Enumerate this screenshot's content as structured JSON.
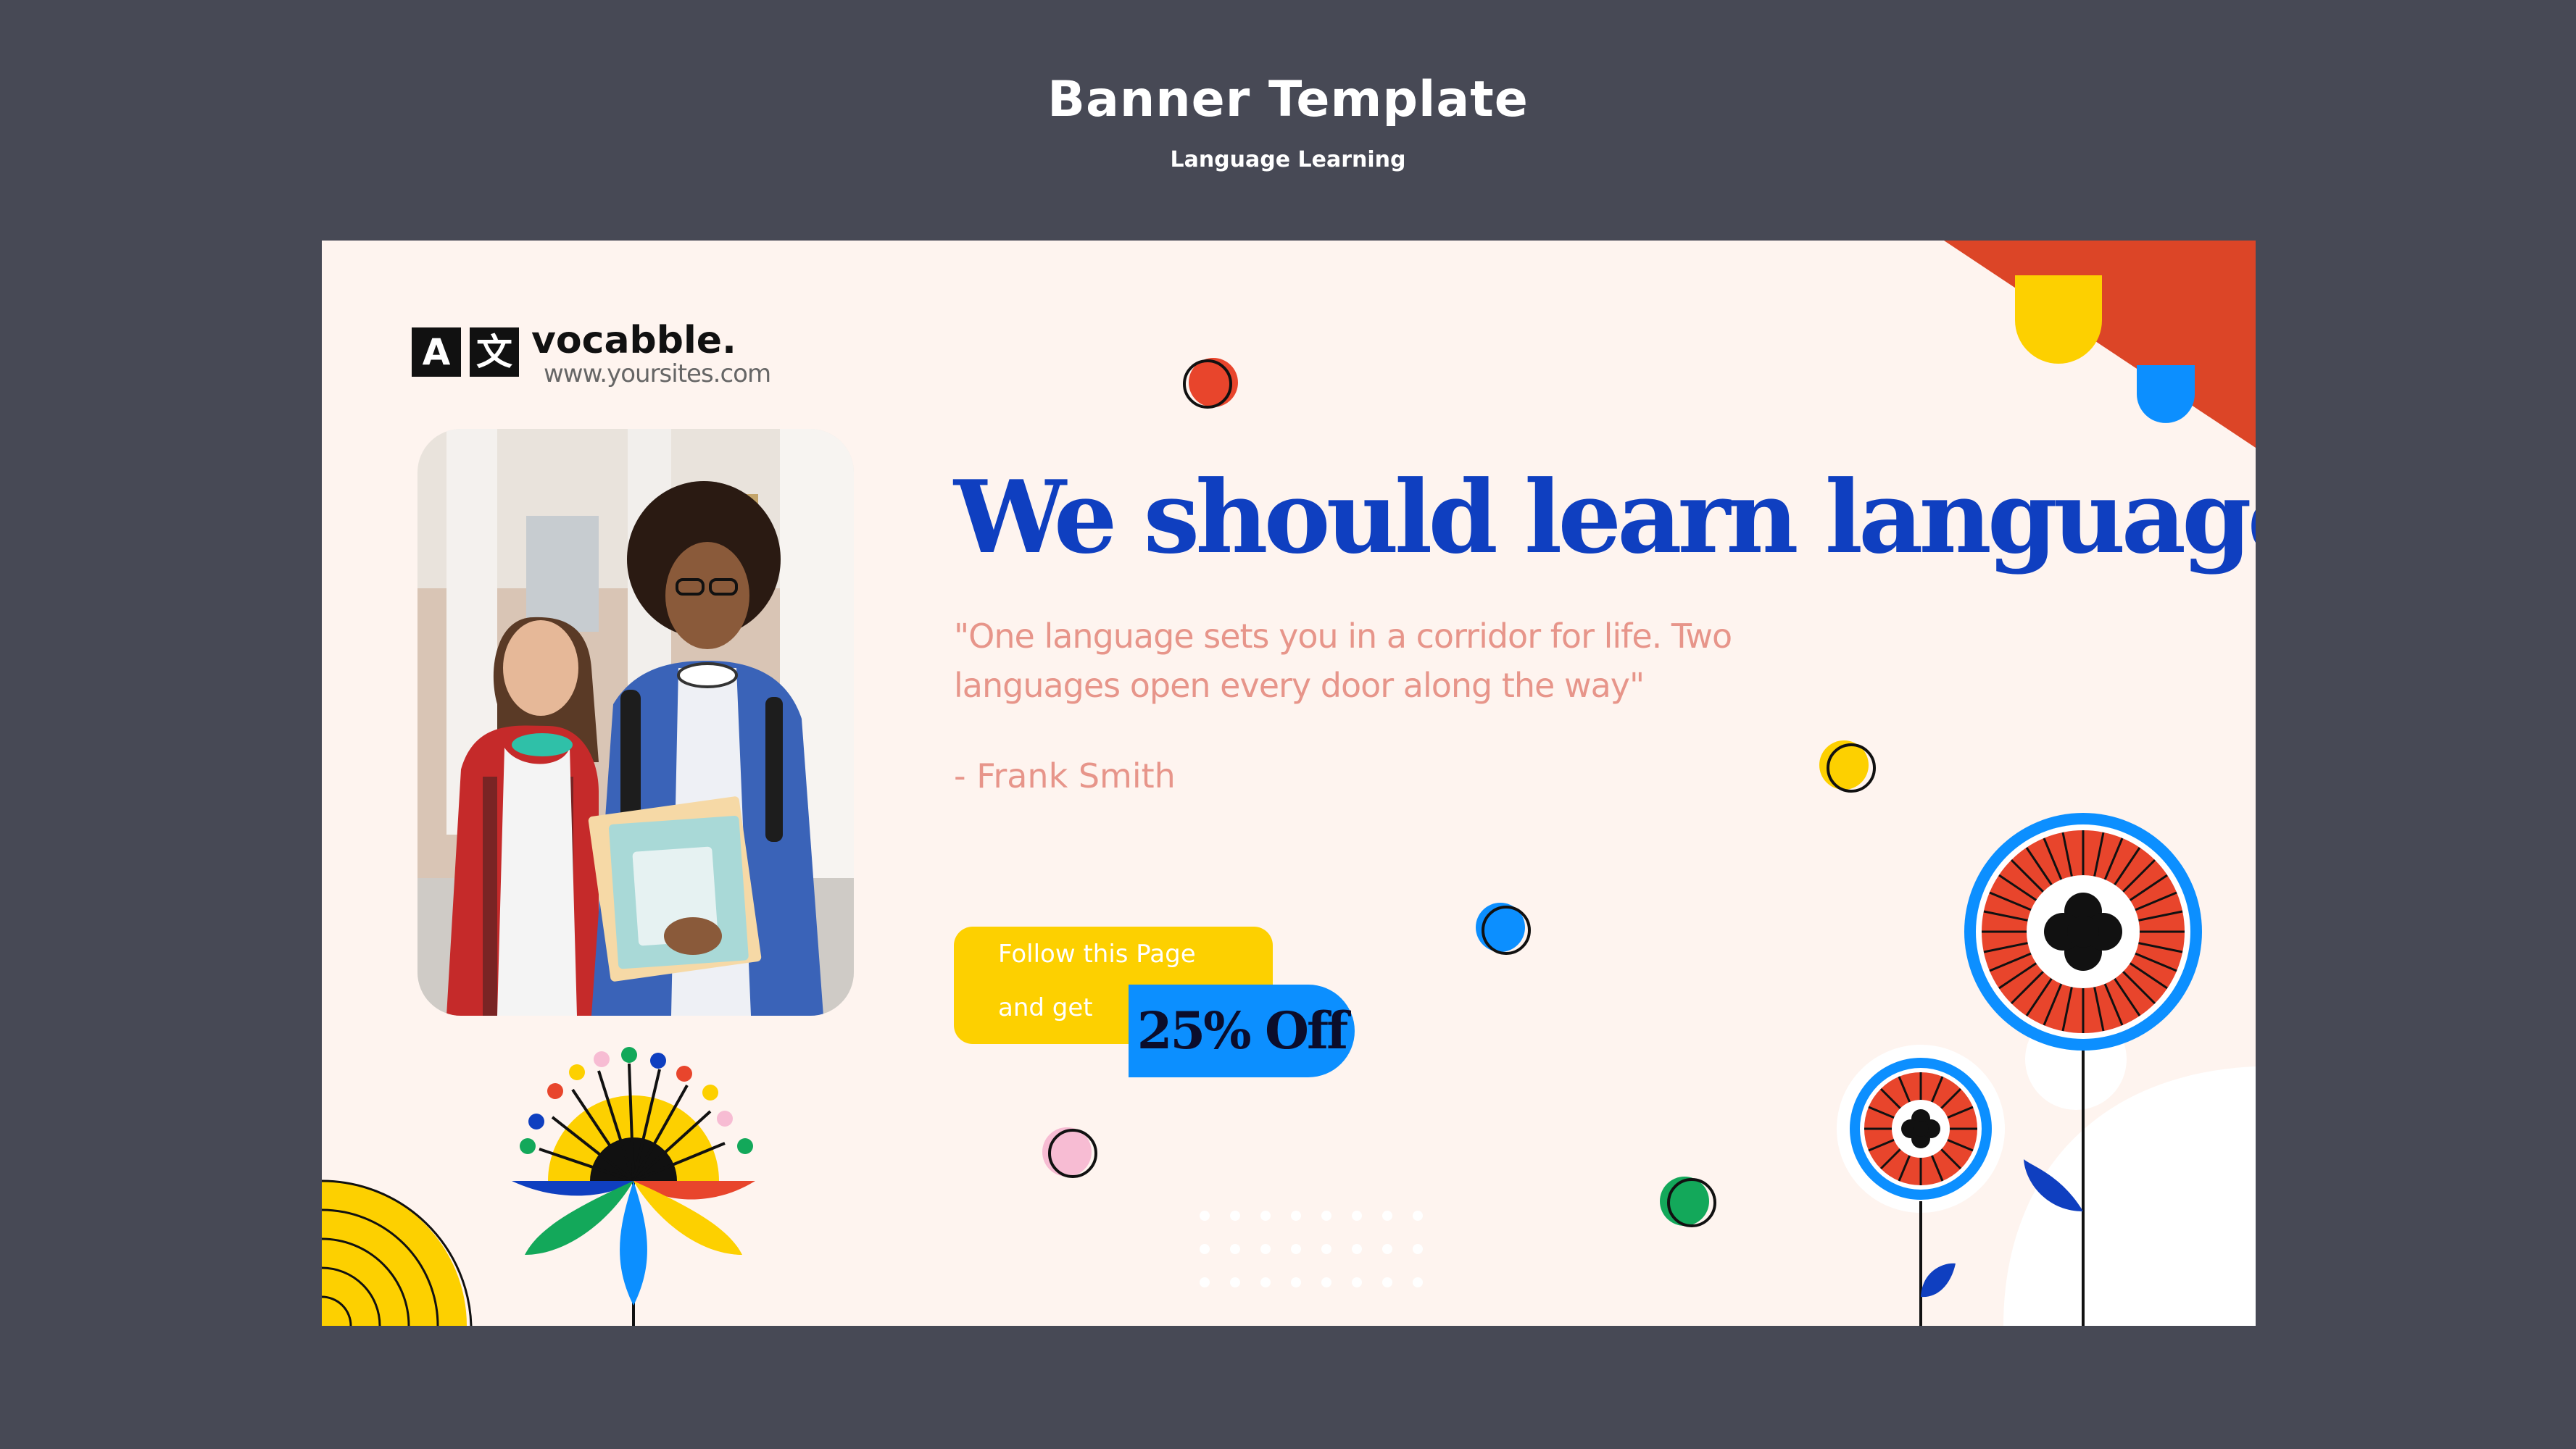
{
  "header": {
    "title": "Banner Template",
    "subtitle": "Language Learning"
  },
  "banner": {
    "logo": {
      "icon_letter": "A",
      "icon_glyph": "文",
      "name": "vocabble.",
      "url": "www.yoursites.com"
    },
    "headline": "We should learn languages",
    "quote_line1": "\"One language sets you in a corridor for life. Two",
    "quote_line2": "languages open every door along the way\"",
    "author": "- Frank Smith",
    "promo": {
      "line1": "Follow this Page",
      "line2": "and get",
      "discount": "25% Off"
    }
  },
  "colors": {
    "page_bg": "#474955",
    "banner_bg": "#fef4ef",
    "headline": "#0f3fc0",
    "quote": "#e7958a",
    "yellow": "#fdd000",
    "blue": "#0c8fff",
    "red": "#e8452c",
    "green": "#13a85a",
    "pink": "#f7bcd3"
  },
  "icons": [
    "translate-icon",
    "sunflower-decoration",
    "red-flower-decoration",
    "dot-decoration"
  ]
}
